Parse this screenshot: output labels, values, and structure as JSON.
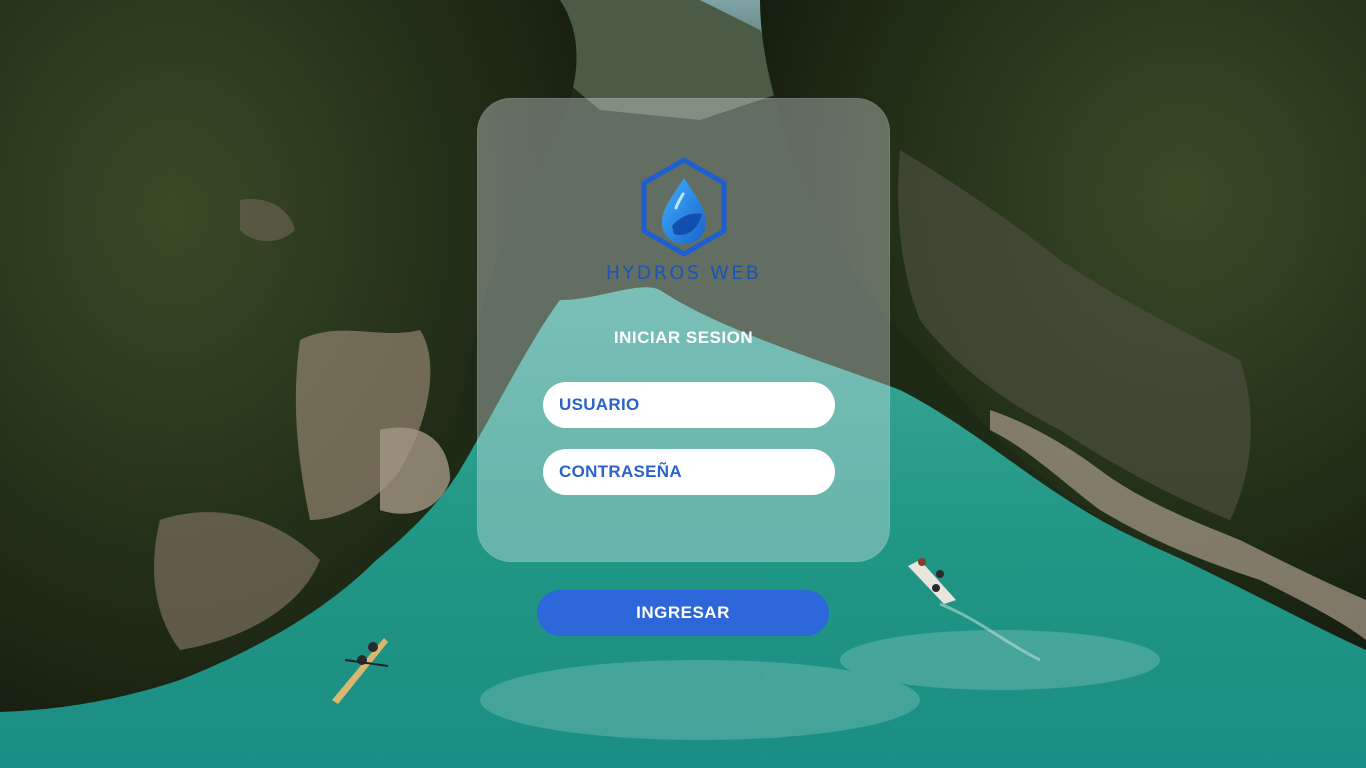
{
  "login": {
    "brand": "HYDROS WEB",
    "title": "INICIAR SESION",
    "username_placeholder": "USUARIO",
    "password_placeholder": "CONTRASEÑA",
    "submit_label": "INGRESAR"
  },
  "background": {
    "photo": "river canyon with kayaks"
  },
  "colors": {
    "brand_blue": "#1e55b4",
    "button_blue": "#2d66d8",
    "field_text": "#2b63c9",
    "water": "#1f9a8c"
  },
  "icons": {
    "logo": "water-drop-hexagon-icon"
  }
}
